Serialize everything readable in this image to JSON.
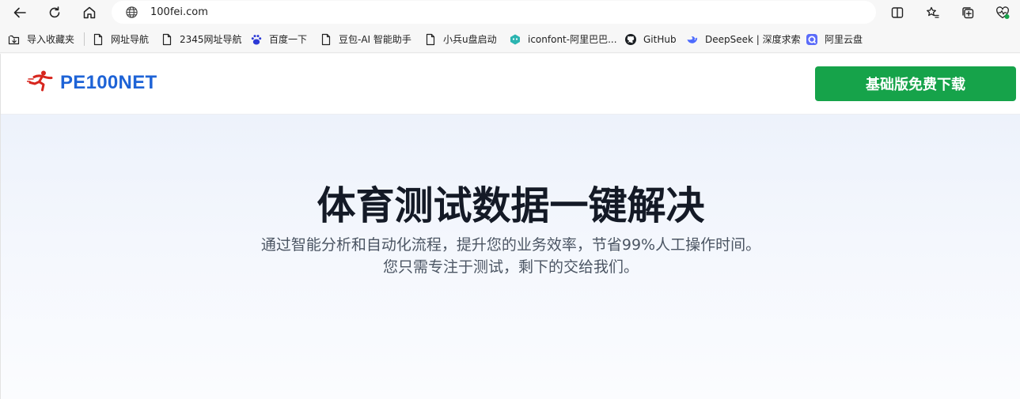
{
  "browser": {
    "url": "100fei.com",
    "bookmarks": [
      {
        "label": "导入收藏夹",
        "icon": "import-folder-icon"
      },
      {
        "label": "网址导航",
        "icon": "page-icon"
      },
      {
        "label": "2345网址导航",
        "icon": "page-icon"
      },
      {
        "label": "百度一下",
        "icon": "baidu-paw-icon"
      },
      {
        "label": "豆包-AI 智能助手",
        "icon": "page-icon"
      },
      {
        "label": "小兵u盘启动",
        "icon": "page-icon"
      },
      {
        "label": "iconfont-阿里巴巴...",
        "icon": "iconfont-icon"
      },
      {
        "label": "GitHub",
        "icon": "github-icon"
      },
      {
        "label": "DeepSeek | 深度求索",
        "icon": "deepseek-whale-icon"
      },
      {
        "label": "阿里云盘",
        "icon": "aliyun-drive-icon"
      }
    ]
  },
  "site": {
    "logo_text": "PE100NET",
    "download_button": "基础版免费下载",
    "brand_color": "#1e63d6",
    "button_color": "#16a34a"
  },
  "hero": {
    "title": "体育测试数据一键解决",
    "subtitle_line1": "通过智能分析和自动化流程，提升您的业务效率，节省99%人工操作时间。",
    "subtitle_line2": "您只需专注于测试，剩下的交给我们。"
  }
}
